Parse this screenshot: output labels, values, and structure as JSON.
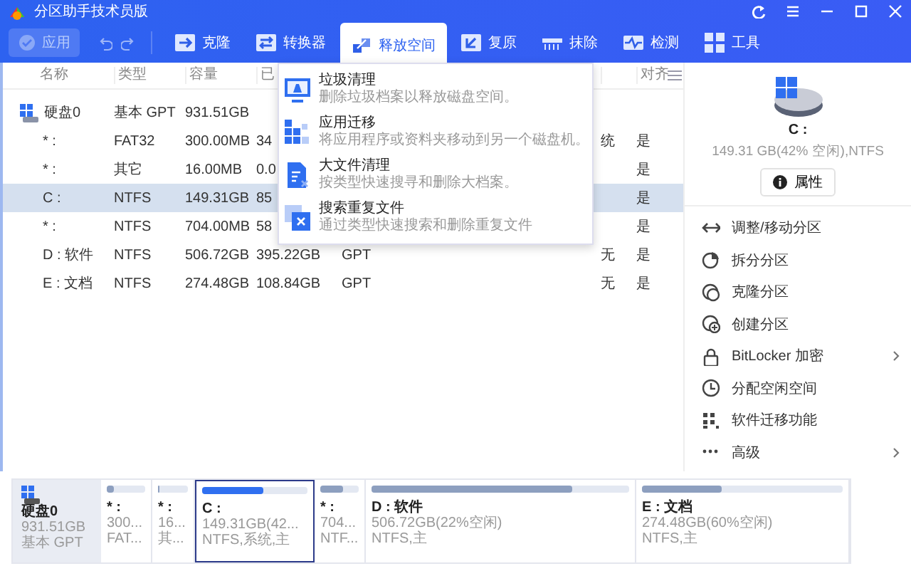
{
  "window": {
    "title": "分区助手技术员版"
  },
  "toolbar": {
    "apply": {
      "label": "应用",
      "disabled": true
    },
    "tools": [
      {
        "label": "克隆",
        "kind": "clone",
        "selected": false
      },
      {
        "label": "转换器",
        "kind": "convert",
        "selected": false
      },
      {
        "label": "释放空间",
        "kind": "free",
        "selected": true
      },
      {
        "label": "复原",
        "kind": "restore",
        "selected": false
      },
      {
        "label": "抹除",
        "kind": "wipe",
        "selected": false
      },
      {
        "label": "检测",
        "kind": "test",
        "selected": false
      },
      {
        "label": "工具",
        "kind": "tools",
        "selected": false
      }
    ]
  },
  "table": {
    "columns": [
      "名称",
      "类型",
      "容量",
      "已",
      "对齐"
    ],
    "rows": [
      {
        "kind": "disk",
        "name": "硬盘0",
        "type": "基本 GPT",
        "capacity": "931.51GB",
        "selected": false
      },
      {
        "kind": "partition",
        "name": "* :",
        "type": "FAT32",
        "capacity": "300.00MB",
        "used": "34",
        "column_6": "统",
        "aligned": "是",
        "selected": false
      },
      {
        "kind": "partition",
        "name": "* :",
        "type": "其它",
        "capacity": "16.00MB",
        "used": "0.0",
        "aligned": "是",
        "selected": false
      },
      {
        "kind": "partition",
        "name": "C :",
        "type": "NTFS",
        "capacity": "149.31GB",
        "used": "85",
        "aligned": "是",
        "selected": true
      },
      {
        "kind": "partition",
        "name": "* :",
        "type": "NTFS",
        "capacity": "704.00MB",
        "used": "58",
        "aligned": "是",
        "selected": false
      },
      {
        "kind": "partition",
        "name": "D : 软件",
        "type": "NTFS",
        "capacity": "506.72GB",
        "used": "395.22GB",
        "column_5": "GPT",
        "column_6": "无",
        "aligned": "是",
        "selected": false
      },
      {
        "kind": "partition",
        "name": "E : 文档",
        "type": "NTFS",
        "capacity": "274.48GB",
        "used": "108.84GB",
        "column_5": "GPT",
        "column_6": "无",
        "aligned": "是",
        "selected": false
      }
    ]
  },
  "free_space_menu": {
    "items": [
      {
        "kind": "junk",
        "title": "垃圾清理",
        "description": "删除垃圾档案以释放磁盘空间。"
      },
      {
        "kind": "app",
        "title": "应用迁移",
        "description": "将应用程序或资料夹移动到另一个磁盘机。"
      },
      {
        "kind": "large",
        "title": "大文件清理",
        "description": "按类型快速搜寻和删除大档案。"
      },
      {
        "kind": "duplicate",
        "title": "搜索重复文件",
        "description": "通过类型快速搜索和删除重复文件"
      }
    ]
  },
  "details": {
    "name": "C :",
    "info": "149.31 GB(42% 空闲),NTFS",
    "properties_button": "属性",
    "actions": [
      {
        "kind": "resize",
        "label": "调整/移动分区",
        "submenu": false
      },
      {
        "kind": "split",
        "label": "拆分分区",
        "submenu": false
      },
      {
        "kind": "clone",
        "label": "克隆分区",
        "submenu": false
      },
      {
        "kind": "create",
        "label": "创建分区",
        "submenu": false
      },
      {
        "kind": "lock",
        "label": "BitLocker 加密",
        "submenu": true
      },
      {
        "kind": "allocate",
        "label": "分配空闲空间",
        "submenu": false
      },
      {
        "kind": "migrate",
        "label": "软件迁移功能",
        "submenu": false
      },
      {
        "kind": "more",
        "label": "高级",
        "submenu": true
      }
    ]
  },
  "disk_map": {
    "disk": {
      "name": "硬盘0",
      "size": "931.51GB",
      "style": "基本 GPT"
    },
    "partitions": [
      {
        "label": "* :",
        "size": "300...",
        "fs": "FAT...",
        "level": 0.2,
        "selected": false
      },
      {
        "label": "* :",
        "size": "16...",
        "fs": "其...",
        "level": 0.05,
        "selected": false
      },
      {
        "label": "C :",
        "size": "149.31GB(42...",
        "fs": "NTFS,系统,主",
        "level": 0.58,
        "selected": true
      },
      {
        "label": "* :",
        "size": "704...",
        "fs": "NTF...",
        "level": 0.6,
        "selected": false
      },
      {
        "label": "D : 软件",
        "size": "506.72GB(22%空闲)",
        "fs": "NTFS,主",
        "level": 0.78,
        "selected": false
      },
      {
        "label": "E : 文档",
        "size": "274.48GB(60%空闲)",
        "fs": "NTFS,主",
        "level": 0.4,
        "selected": false
      }
    ]
  }
}
